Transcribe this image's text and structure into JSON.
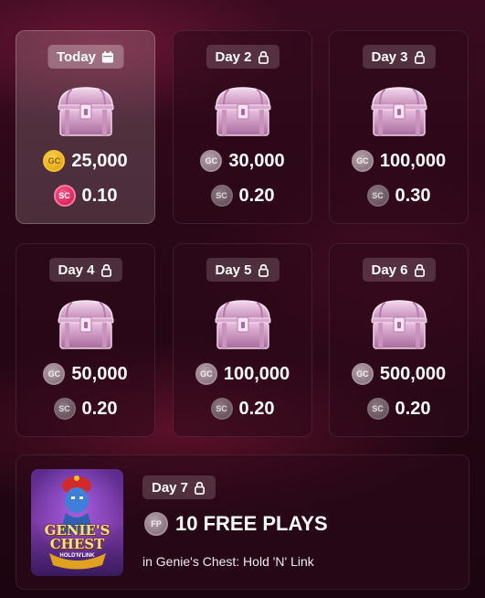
{
  "days": [
    {
      "label": "Today",
      "status_icon": "calendar-icon",
      "state": "current",
      "gc_coin_label": "GC",
      "gc_amount": "25,000",
      "sc_coin_label": "SC",
      "sc_amount": "0.10"
    },
    {
      "label": "Day 2",
      "status_icon": "lock-icon",
      "state": "locked",
      "gc_coin_label": "GC",
      "gc_amount": "30,000",
      "sc_coin_label": "SC",
      "sc_amount": "0.20"
    },
    {
      "label": "Day 3",
      "status_icon": "lock-icon",
      "state": "locked",
      "gc_coin_label": "GC",
      "gc_amount": "100,000",
      "sc_coin_label": "SC",
      "sc_amount": "0.30"
    },
    {
      "label": "Day 4",
      "status_icon": "lock-icon",
      "state": "locked",
      "gc_coin_label": "GC",
      "gc_amount": "50,000",
      "sc_coin_label": "SC",
      "sc_amount": "0.20"
    },
    {
      "label": "Day 5",
      "status_icon": "lock-icon",
      "state": "locked",
      "gc_coin_label": "GC",
      "gc_amount": "100,000",
      "sc_coin_label": "SC",
      "sc_amount": "0.20"
    },
    {
      "label": "Day 6",
      "status_icon": "lock-icon",
      "state": "locked",
      "gc_coin_label": "GC",
      "gc_amount": "500,000",
      "sc_coin_label": "SC",
      "sc_amount": "0.20"
    }
  ],
  "day7": {
    "label": "Day 7",
    "status_icon": "lock-icon",
    "fp_coin_label": "FP",
    "reward": "10 FREE PLAYS",
    "game": "in Genie's Chest: Hold 'N' Link",
    "thumbnail_title": "GENIE'S CHEST",
    "thumbnail_subtitle": "HOLD'N'LINK"
  },
  "colors": {
    "gc_active": "#f4c430",
    "sc_active": "#e8175d",
    "coin_locked": "#9a8690",
    "card_active_bg": "rgba(255,255,255,0.16)"
  }
}
